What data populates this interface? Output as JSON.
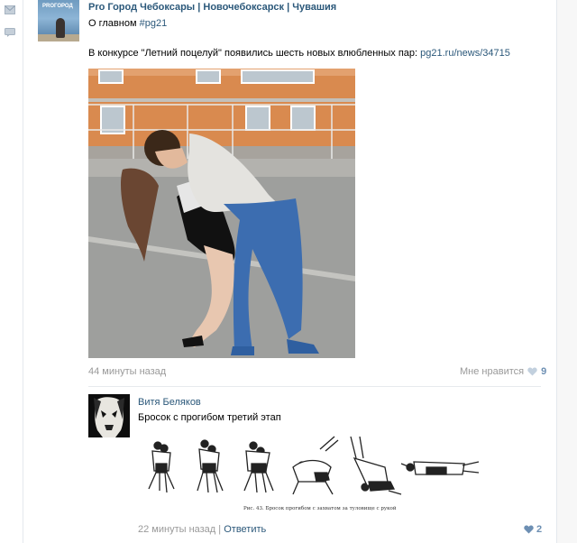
{
  "post": {
    "author": "Pro Город Чебоксары | Новочебоксарск | Чувашия",
    "avatar_text": "PROГОРОД",
    "section": "О главном",
    "hashtag": "#pg21",
    "text": "В конкурсе \"Летний поцелуй\" появились шесть новых влюбленных пар:",
    "link": "pg21.ru/news/34715",
    "time": "44 минуты назад",
    "like_label": "Мне нравится",
    "like_count": "9"
  },
  "comment": {
    "author": "Витя Беляков",
    "text": "Бросок с прогибом третий этап",
    "figure_caption": "Рис. 43. Бросок прогибом с захватом за туловище с рукой",
    "time": "22 минуты назад",
    "separator": "|",
    "reply": "Ответить",
    "like_count": "2"
  },
  "icons": {
    "rail_top": "mail-icon",
    "rail_bottom": "comment-icon",
    "like": "heart-icon"
  },
  "colors": {
    "link": "#2b587a",
    "muted": "#999999",
    "like": "#6d8fb3"
  }
}
